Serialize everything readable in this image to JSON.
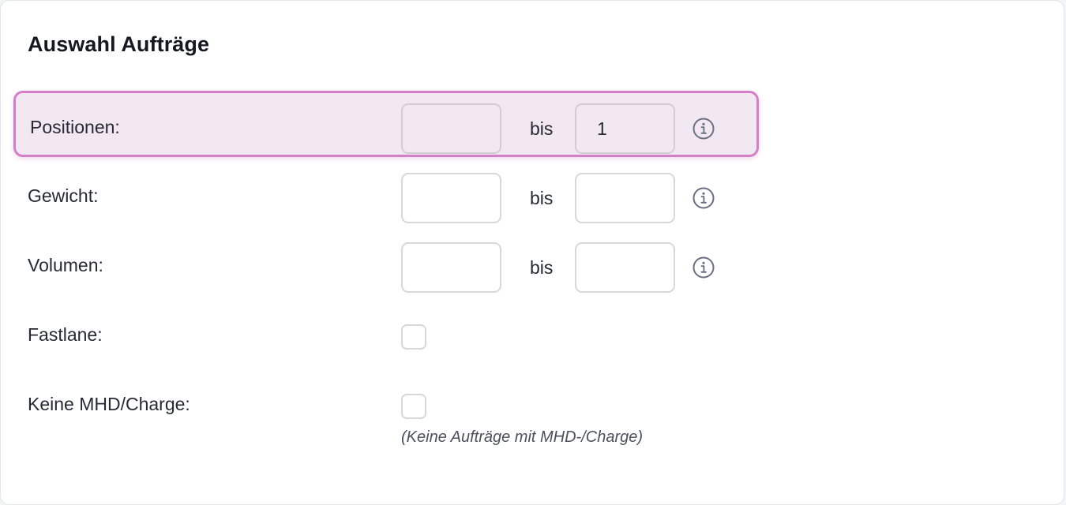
{
  "section": {
    "title": "Auswahl Aufträge"
  },
  "ranges": [
    {
      "label": "Positionen:",
      "from_value": "",
      "separator": "bis",
      "to_value": "1",
      "highlighted": true
    },
    {
      "label": "Gewicht:",
      "from_value": "",
      "separator": "bis",
      "to_value": "",
      "highlighted": false
    },
    {
      "label": "Volumen:",
      "from_value": "",
      "separator": "bis",
      "to_value": "",
      "highlighted": false
    }
  ],
  "checkboxes": [
    {
      "label": "Fastlane:",
      "checked": false
    },
    {
      "label": "Keine MHD/Charge:",
      "checked": false,
      "hint": "(Keine Aufträge mit MHD-/Charge)"
    }
  ],
  "colors": {
    "highlight_border": "#d67ec8",
    "highlight_background": "#f2e8f1",
    "input_border": "#d7d8dc",
    "info_icon": "#6b6f80"
  },
  "icons": {
    "info": "info-circle-icon"
  }
}
